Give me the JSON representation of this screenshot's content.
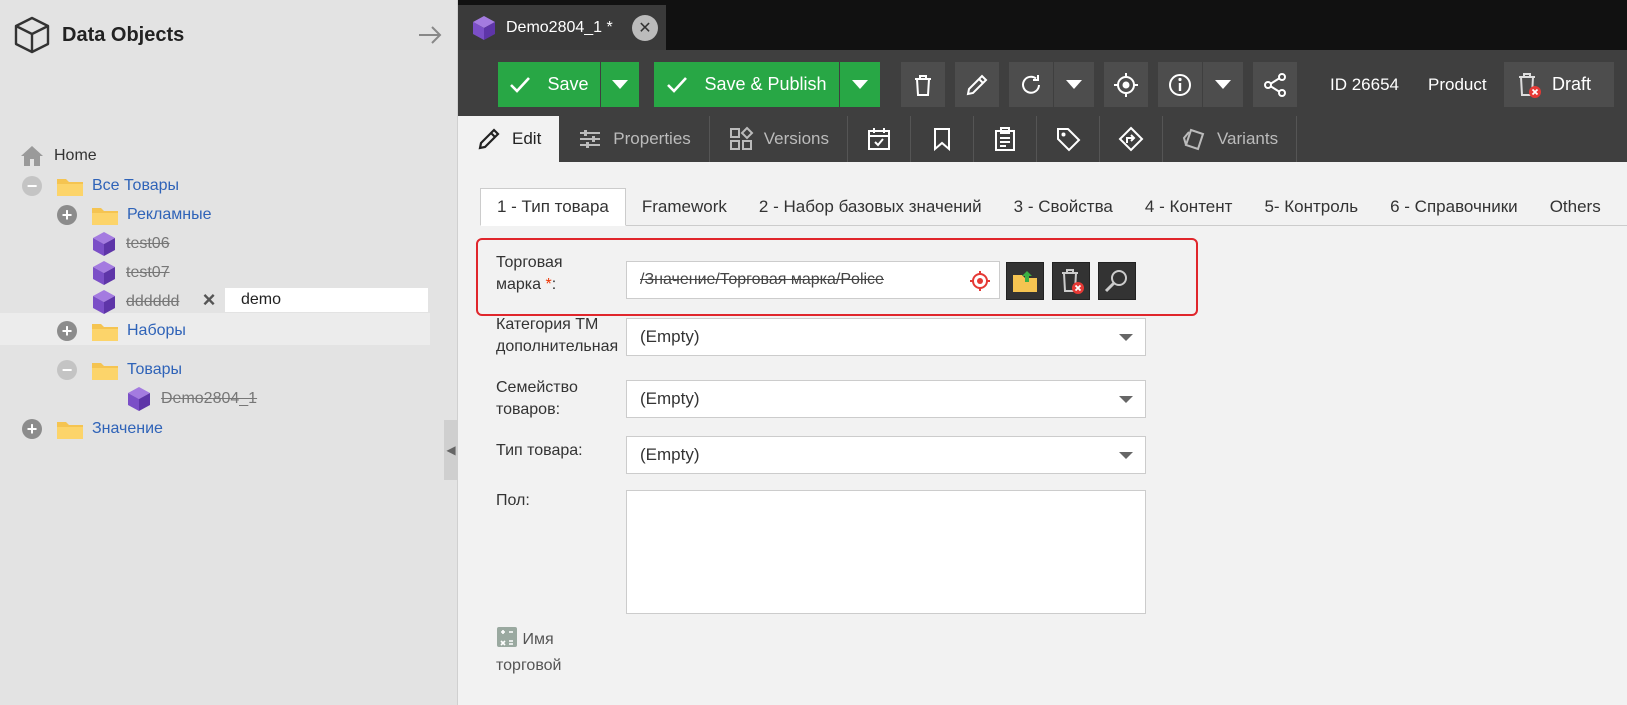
{
  "left_panel": {
    "title": "Data Objects",
    "tree": {
      "home": "Home",
      "all_goods": "Все Товары",
      "ads": "Рекламные",
      "test06": "test06",
      "test07": "test07",
      "dddddd": "dddddd",
      "sets": "Наборы",
      "goods": "Товары",
      "filter_value": "demo",
      "demo_obj": "Demo2804_1",
      "value": "Значение"
    }
  },
  "document_tab": {
    "title": "Demo2804_1 *"
  },
  "toolbar": {
    "save": "Save",
    "save_publish": "Save & Publish",
    "id": "ID 26654",
    "class_name": "Product",
    "draft": "Draft"
  },
  "subtabs": {
    "edit": "Edit",
    "properties": "Properties",
    "versions": "Versions",
    "variants": "Variants"
  },
  "form_tabs": [
    "1 - Тип товара",
    "Framework",
    "2 - Набор базовых значений",
    "3 - Свойства",
    "4 - Контент",
    "5- Контроль",
    "6 - Справочники",
    "Others"
  ],
  "form": {
    "brand_label_1": "Торговая",
    "brand_label_2": "марка",
    "brand_required": "*",
    "brand_colon": ":",
    "brand_value": "/Значение/Торговая марка/Police",
    "category_label_1": "Категория ТМ",
    "category_label_2": "дополнительная",
    "category_value": "(Empty)",
    "family_label_1": "Семейство",
    "family_label_2": "товаров:",
    "family_value": "(Empty)",
    "type_label": "Тип товара:",
    "type_value": "(Empty)",
    "gender_label": "Пол:",
    "calc_label_1": "Имя",
    "calc_label_2": "торговой"
  },
  "colors": {
    "green": "#28a745",
    "dark_toolbar": "#3f3f3f",
    "highlight_red": "#e0262c",
    "link_blue": "#2f63b8"
  }
}
